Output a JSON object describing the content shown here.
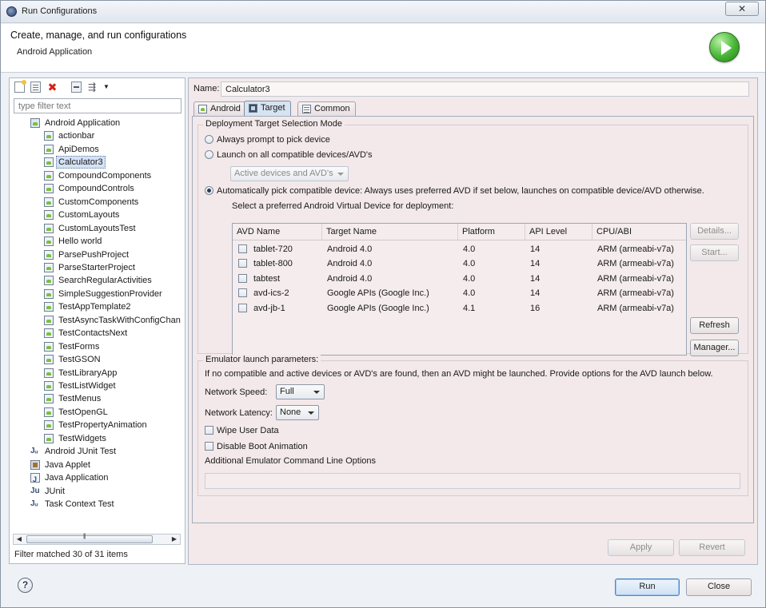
{
  "window": {
    "title": "Run Configurations",
    "close_glyph": "✕"
  },
  "header": {
    "title": "Create, manage, and run configurations",
    "subtitle": "Android Application",
    "badge_icon": "run-icon"
  },
  "left": {
    "toolbar": [
      {
        "icon": "new-configuration-icon"
      },
      {
        "icon": "duplicate-icon"
      },
      {
        "icon": "delete-icon",
        "glyph": "✖"
      },
      {
        "icon": "collapse-all-icon"
      },
      {
        "icon": "filter-icon",
        "glyph": "⇶"
      },
      {
        "icon": "view-menu-icon",
        "glyph": "▼"
      }
    ],
    "filter_placeholder": "type filter text",
    "tree": [
      {
        "label": "Android Application",
        "level": 1,
        "icon": "android-group"
      },
      {
        "label": "actionbar",
        "level": 2,
        "icon": "android"
      },
      {
        "label": "ApiDemos",
        "level": 2,
        "icon": "android"
      },
      {
        "label": "Calculator3",
        "level": 2,
        "icon": "android",
        "selected": true
      },
      {
        "label": "CompoundComponents",
        "level": 2,
        "icon": "android"
      },
      {
        "label": "CompoundControls",
        "level": 2,
        "icon": "android"
      },
      {
        "label": "CustomComponents",
        "level": 2,
        "icon": "android"
      },
      {
        "label": "CustomLayouts",
        "level": 2,
        "icon": "android"
      },
      {
        "label": "CustomLayoutsTest",
        "level": 2,
        "icon": "android"
      },
      {
        "label": "Hello world",
        "level": 2,
        "icon": "android"
      },
      {
        "label": "ParsePushProject",
        "level": 2,
        "icon": "android"
      },
      {
        "label": "ParseStarterProject",
        "level": 2,
        "icon": "android"
      },
      {
        "label": "SearchRegularActivities",
        "level": 2,
        "icon": "android"
      },
      {
        "label": "SimpleSuggestionProvider",
        "level": 2,
        "icon": "android"
      },
      {
        "label": "TestAppTemplate2",
        "level": 2,
        "icon": "android"
      },
      {
        "label": "TestAsyncTaskWithConfigChan",
        "level": 2,
        "icon": "android"
      },
      {
        "label": "TestContactsNext",
        "level": 2,
        "icon": "android"
      },
      {
        "label": "TestForms",
        "level": 2,
        "icon": "android"
      },
      {
        "label": "TestGSON",
        "level": 2,
        "icon": "android"
      },
      {
        "label": "TestLibraryApp",
        "level": 2,
        "icon": "android"
      },
      {
        "label": "TestListWidget",
        "level": 2,
        "icon": "android"
      },
      {
        "label": "TestMenus",
        "level": 2,
        "icon": "android"
      },
      {
        "label": "TestOpenGL",
        "level": 2,
        "icon": "android"
      },
      {
        "label": "TestPropertyAnimation",
        "level": 2,
        "icon": "android"
      },
      {
        "label": "TestWidgets",
        "level": 2,
        "icon": "android"
      },
      {
        "label": "Android JUnit Test",
        "level": 1,
        "icon": "junit",
        "glyph": "Jᵤ"
      },
      {
        "label": "Java Applet",
        "level": 1,
        "icon": "applet"
      },
      {
        "label": "Java Application",
        "level": 1,
        "icon": "japp"
      },
      {
        "label": "JUnit",
        "level": 1,
        "icon": "junit",
        "glyph": "Ju"
      },
      {
        "label": "Task Context Test",
        "level": 1,
        "icon": "junit",
        "glyph": "Jᵤ"
      }
    ],
    "scroll_left": "◀",
    "scroll_right": "▶",
    "filter_status": "Filter matched 30 of 31 items"
  },
  "right": {
    "name_label": "Name:",
    "name_value": "Calculator3",
    "tabs": [
      {
        "label": "Android",
        "icon": "android",
        "active": false
      },
      {
        "label": "Target",
        "icon": "target",
        "active": true
      },
      {
        "label": "Common",
        "icon": "common",
        "active": false
      }
    ],
    "deployment": {
      "title": "Deployment Target Selection Mode",
      "always_prompt": "Always prompt to pick device",
      "launch_all": "Launch on all compatible devices/AVD's",
      "active_devices": "Active devices and AVD's",
      "auto_pick": "Automatically pick compatible device: Always uses preferred AVD if set below, launches on compatible device/AVD otherwise.",
      "select_label": "Select a preferred Android Virtual Device for deployment:",
      "selected_mode": "auto_pick"
    },
    "avd_columns": [
      "AVD Name",
      "Target Name",
      "Platform",
      "API Level",
      "CPU/ABI"
    ],
    "avd_rows": [
      {
        "name": "tablet-720",
        "target": "Android 4.0",
        "platform": "4.0",
        "api": "14",
        "abi": "ARM (armeabi-v7a)"
      },
      {
        "name": "tablet-800",
        "target": "Android 4.0",
        "platform": "4.0",
        "api": "14",
        "abi": "ARM (armeabi-v7a)"
      },
      {
        "name": "tabtest",
        "target": "Android 4.0",
        "platform": "4.0",
        "api": "14",
        "abi": "ARM (armeabi-v7a)"
      },
      {
        "name": "avd-ics-2",
        "target": "Google APIs (Google Inc.)",
        "platform": "4.0",
        "api": "14",
        "abi": "ARM (armeabi-v7a)"
      },
      {
        "name": "avd-jb-1",
        "target": "Google APIs (Google Inc.)",
        "platform": "4.1",
        "api": "16",
        "abi": "ARM (armeabi-v7a)"
      }
    ],
    "avd_buttons": {
      "details": "Details...",
      "start": "Start...",
      "refresh": "Refresh",
      "manager": "Manager..."
    },
    "emulator": {
      "title": "Emulator launch parameters:",
      "note": "If no compatible and active devices or AVD's are found, then an AVD might be launched. Provide options for the AVD launch below.",
      "network_speed_label": "Network Speed:",
      "network_speed": "Full",
      "network_latency_label": "Network Latency:",
      "network_latency": "None",
      "wipe_user_data": "Wipe User Data",
      "disable_boot_animation": "Disable Boot Animation",
      "additional_options_label": "Additional Emulator Command Line Options",
      "additional_options_value": ""
    },
    "apply": "Apply",
    "revert": "Revert"
  },
  "footer": {
    "help_glyph": "?",
    "run": "Run",
    "close": "Close"
  }
}
